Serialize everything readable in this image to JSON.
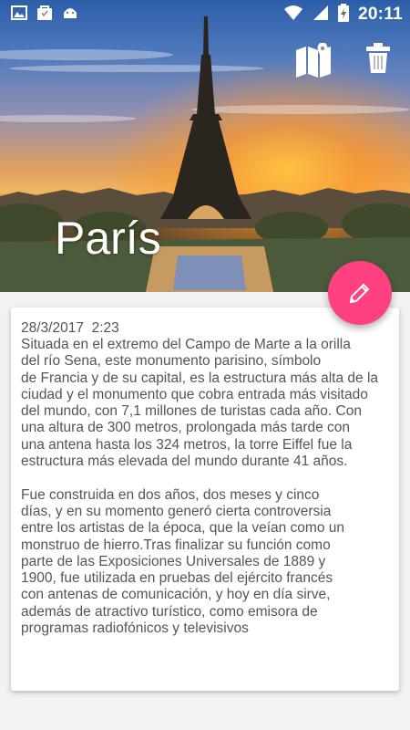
{
  "status_bar": {
    "time": "20:11",
    "left_icons": [
      "image-icon",
      "shopping-bag-icon",
      "android-icon"
    ],
    "right_icons": [
      "wifi-icon",
      "signal-icon",
      "battery-charging-icon"
    ]
  },
  "header": {
    "title": "París",
    "actions": [
      "map-icon",
      "trash-icon"
    ]
  },
  "fab": {
    "icon": "pencil-icon",
    "color": "#ff4081"
  },
  "note": {
    "date": "28/3/2017  2:23",
    "body": "Situada en el extremo del Campo de Marte a la orilla\ndel río Sena, este monumento parisino, símbolo\nde Francia y de su capital, es la estructura más alta de la\nciudad y el monumento que cobra entrada más visitado\ndel mundo, con 7,1 millones de turistas cada año. Con\nuna altura de 300 metros, prolongada más tarde con\nuna antena hasta los 324 metros, la torre Eiffel fue la\nestructura más elevada del mundo durante 41 años.\n\nFue construida en dos años, dos meses y cinco\ndías, y en su momento generó cierta controversia\nentre los artistas de la época, que la veían como un\nmonstruo de hierro.Tras finalizar su función como\nparte de las Exposiciones Universales de 1889 y\n1900, fue utilizada en pruebas del ejército francés\ncon antenas de comunicación, y hoy en día sirve,\nademás de atractivo turístico, como emisora de\nprogramas radiofónicos y televisivos"
  }
}
